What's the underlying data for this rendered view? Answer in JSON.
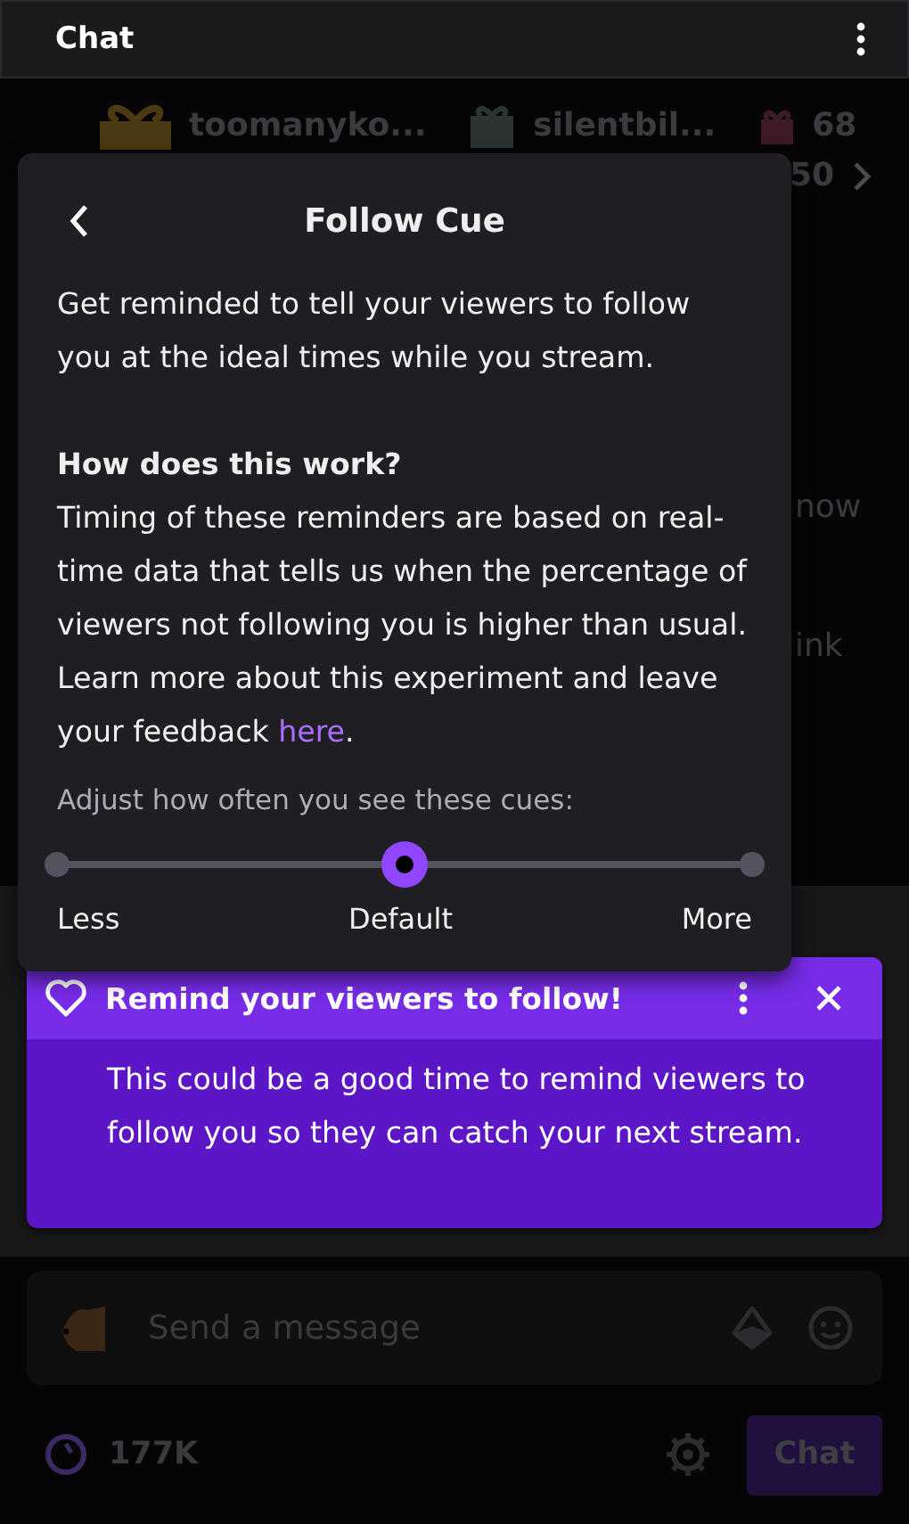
{
  "header": {
    "title": "Chat"
  },
  "gifts": [
    {
      "name": "toomanyko...",
      "kind": "gold"
    },
    {
      "name": "silentbil...",
      "kind": "teal"
    },
    {
      "name": "68",
      "kind": "red"
    }
  ],
  "gift_count_2": "50",
  "background_fragments": [
    "now",
    "ink"
  ],
  "popover": {
    "title": "Follow Cue",
    "intro": "Get reminded to tell your viewers to follow you at the ideal times while you stream.",
    "heading": "How does this work?",
    "body": "Timing of these reminders are based on real-time data that tells us when the percentage of viewers not following you is higher than usual. Learn more about this experiment and leave your feedback ",
    "link": "here",
    "end": ".",
    "slider": {
      "label": "Adjust how often you see these cues:",
      "level": 0.5,
      "stops": [
        "Less",
        "Default",
        "More"
      ]
    }
  },
  "notification": {
    "title": "Remind your viewers to follow!",
    "body": "This could be a good time to remind viewers to follow you so they can catch your next stream."
  },
  "input": {
    "placeholder": "Send a message"
  },
  "footer": {
    "points": "177K",
    "button": "Chat"
  }
}
